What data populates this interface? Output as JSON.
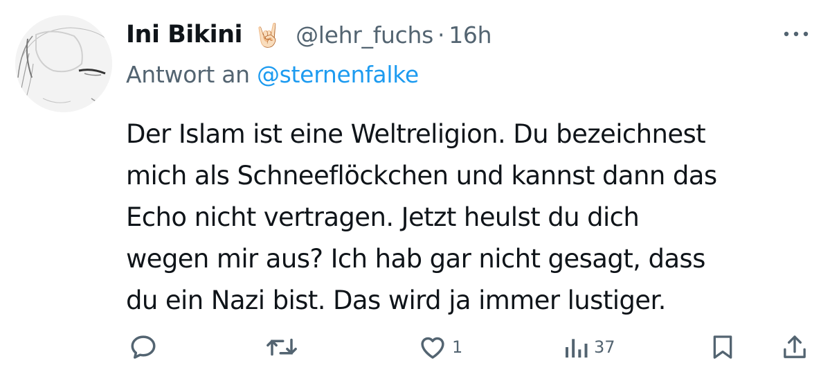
{
  "author": {
    "display_name": "Ini Bikini",
    "emoji": "🤘🏻",
    "handle": "@lehr_fuchs",
    "separator": "·",
    "time": "16h"
  },
  "reply": {
    "prefix": "Antwort an",
    "mention": "@sternenfalke"
  },
  "tweet": {
    "lines": [
      "Der Islam ist eine Weltreligion. Du bezeichnest",
      "mich als Schneeflöckchen und kannst dann das",
      "Echo nicht vertragen. Jetzt heulst du dich",
      "wegen mir aus? Ich hab gar nicht gesagt, dass",
      "du ein Nazi bist. Das wird ja immer lustiger."
    ]
  },
  "actions": {
    "like_count": "1",
    "views_count": "37"
  },
  "colors": {
    "text": "#0f1419",
    "secondary": "#536471",
    "link": "#1d9bf0"
  },
  "icons": [
    "avatar-image",
    "more-icon",
    "reply-icon",
    "retweet-icon",
    "like-icon",
    "views-icon",
    "bookmark-icon",
    "share-icon"
  ]
}
